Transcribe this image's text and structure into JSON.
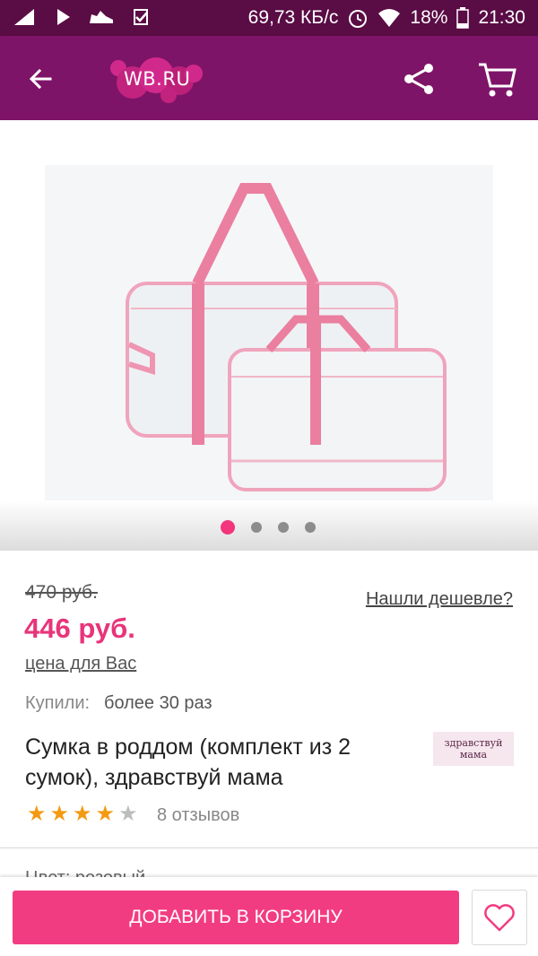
{
  "status_bar": {
    "network_speed": "69,73 КБ/с",
    "battery": "18%",
    "time": "21:30",
    "icons": [
      "signal-icon",
      "play-icon",
      "shoe-icon",
      "check-icon",
      "alarm-icon",
      "wifi-icon",
      "battery-icon"
    ]
  },
  "app_bar": {
    "logo_text": "WB.RU",
    "colors": {
      "bar": "#7e1467",
      "status": "#5a0c45",
      "logo_circles": "#d1298b"
    }
  },
  "gallery": {
    "image_alt": "Прозрачные сумки с розовыми ручками",
    "slide_count": 4,
    "active_slide": 1
  },
  "pricing": {
    "old_price": "470 руб.",
    "price": "446 руб.",
    "price_for_you": "цена для Вас",
    "found_cheaper": "Нашли дешевле?",
    "accent": "#e8347a"
  },
  "purchases": {
    "label": "Купили:",
    "value": "более 30 раз"
  },
  "product": {
    "title": "Сумка в роддом (комплект из 2 сумок), здравствуй мама",
    "brand_logo_text": "здравствуй мама",
    "rating": 4,
    "max_rating": 5,
    "reviews": "8 отзывов"
  },
  "color_peek": "Цвет: розовый",
  "actions": {
    "add_to_cart": "ДОБАВИТЬ В КОРЗИНУ",
    "button_color": "#f23c82"
  }
}
